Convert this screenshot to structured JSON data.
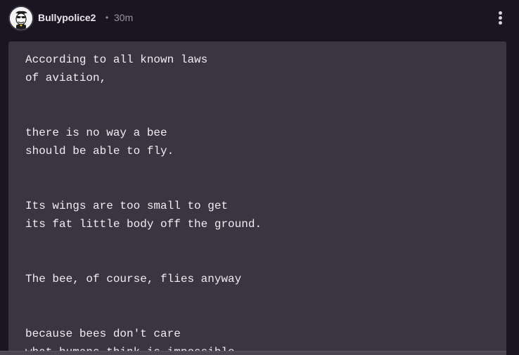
{
  "post": {
    "author": "Bullypolice2",
    "separator": "•",
    "time": "30m",
    "menu_icon": "more-vertical-icon",
    "avatar_icon": "cartoon-face-avatar",
    "code_lines": [
      "According to all known laws",
      "of aviation,",
      "",
      "",
      "there is no way a bee",
      "should be able to fly.",
      "",
      "",
      "Its wings are too small to get",
      "its fat little body off the ground.",
      "",
      "",
      "The bee, of course, flies anyway",
      "",
      "",
      "because bees don't care",
      "what humans think is impossible."
    ]
  },
  "colors": {
    "background": "#1a1520",
    "code_background": "#3a3541",
    "text": "#f0eef3",
    "muted": "#9a94a3"
  }
}
